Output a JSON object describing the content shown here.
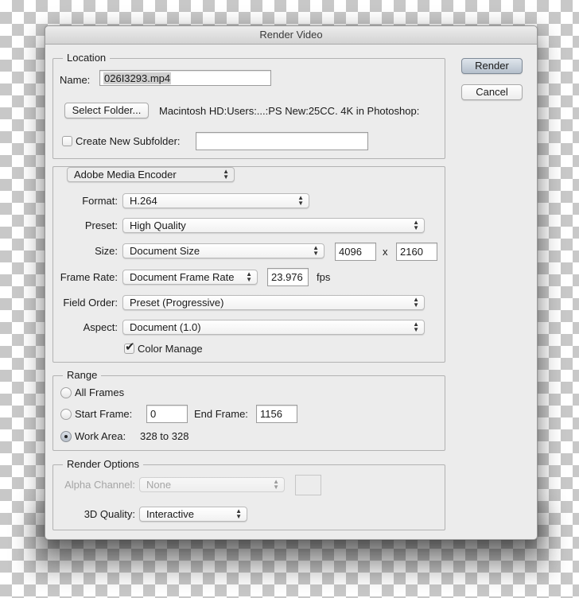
{
  "dialog": {
    "title": "Render Video",
    "buttons": {
      "render": "Render",
      "cancel": "Cancel"
    }
  },
  "location": {
    "legend": "Location",
    "name_label": "Name:",
    "name_value": "026I3293.mp4",
    "select_folder": "Select Folder...",
    "folder_path": "Macintosh HD:Users:...:PS New:25CC. 4K in Photoshop:",
    "create_subfolder_label": "Create New Subfolder:",
    "create_subfolder_checked": false,
    "subfolder_value": ""
  },
  "encoder": {
    "selected": "Adobe Media Encoder",
    "format_label": "Format:",
    "format": "H.264",
    "preset_label": "Preset:",
    "preset": "High Quality",
    "size_label": "Size:",
    "size": "Document Size",
    "width": "4096",
    "size_separator": "x",
    "height": "2160",
    "frame_rate_label": "Frame Rate:",
    "frame_rate": "Document Frame Rate",
    "fps_value": "23.976",
    "fps_unit": "fps",
    "field_order_label": "Field Order:",
    "field_order": "Preset (Progressive)",
    "aspect_label": "Aspect:",
    "aspect": "Document (1.0)",
    "color_manage_label": "Color Manage",
    "color_manage_checked": true
  },
  "range": {
    "legend": "Range",
    "all_frames": "All Frames",
    "start_frame_label": "Start Frame:",
    "start_frame": "0",
    "end_frame_label": "End Frame:",
    "end_frame": "1156",
    "work_area_label": "Work Area:",
    "work_area_value": "328 to 328",
    "selected": "Work Area"
  },
  "render_options": {
    "legend": "Render Options",
    "alpha_label": "Alpha Channel:",
    "alpha": "None",
    "quality_label": "3D Quality:",
    "quality": "Interactive"
  },
  "icons": {
    "updown": "↕",
    "check": "✔"
  }
}
